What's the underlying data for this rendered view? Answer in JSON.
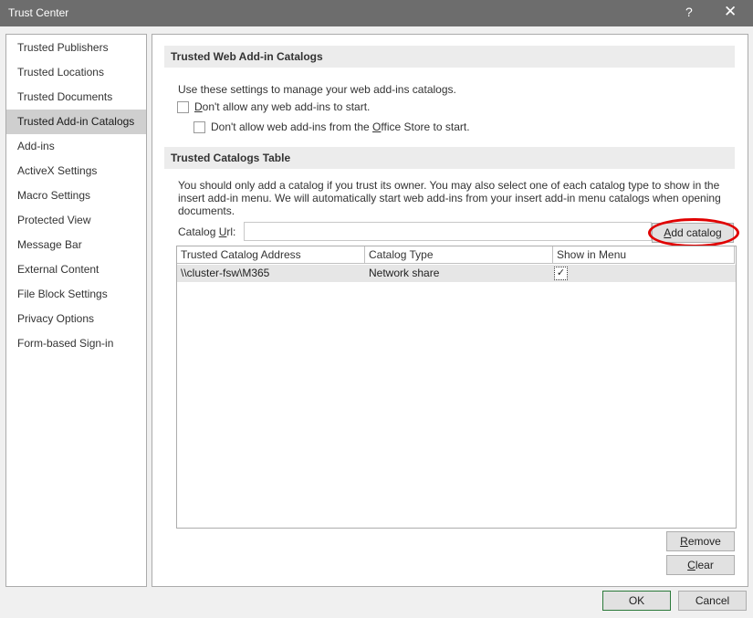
{
  "window": {
    "title": "Trust Center",
    "help_glyph": "?",
    "close_glyph": "✕"
  },
  "sidebar": {
    "items": [
      {
        "label": "Trusted Publishers"
      },
      {
        "label": "Trusted Locations"
      },
      {
        "label": "Trusted Documents"
      },
      {
        "label": "Trusted Add-in Catalogs"
      },
      {
        "label": "Add-ins"
      },
      {
        "label": "ActiveX Settings"
      },
      {
        "label": "Macro Settings"
      },
      {
        "label": "Protected View"
      },
      {
        "label": "Message Bar"
      },
      {
        "label": "External Content"
      },
      {
        "label": "File Block Settings"
      },
      {
        "label": "Privacy Options"
      },
      {
        "label": "Form-based Sign-in"
      }
    ],
    "selected": "Trusted Add-in Catalogs"
  },
  "web_catalogs": {
    "header": "Trusted Web Add-in Catalogs",
    "intro": "Use these settings to manage your web add-ins catalogs.",
    "opt1_pre": "",
    "opt1_key": "D",
    "opt1_post": "on't allow any web add-ins to start.",
    "opt2_pre": "Don't allow web add-ins from the ",
    "opt2_key": "O",
    "opt2_post": "ffice Store to start."
  },
  "catalogs_table": {
    "header": "Trusted Catalogs Table",
    "description": "You should only add a catalog if you trust its owner. You may also select one of each catalog type to show in the insert add-in menu. We will automatically start web add-ins from your insert add-in menu catalogs when opening documents.",
    "url_label_pre": "Catalog ",
    "url_label_key": "U",
    "url_label_post": "rl:",
    "url_value": "",
    "add_key": "A",
    "add_rest": "dd catalog",
    "columns": [
      "Trusted Catalog Address",
      "Catalog Type",
      "Show in Menu"
    ],
    "rows": [
      {
        "address": "\\\\cluster-fsw\\M365",
        "type": "Network share",
        "show_in_menu": "✓"
      }
    ],
    "remove_key": "R",
    "remove_rest": "emove",
    "clear_key": "C",
    "clear_rest": "lear"
  },
  "footer": {
    "ok_label": "OK",
    "cancel_label": "Cancel"
  },
  "colors": {
    "annotation_ring": "#e00000",
    "titlebar": "#6d6d6d",
    "ok_border": "#2b7a3a"
  }
}
